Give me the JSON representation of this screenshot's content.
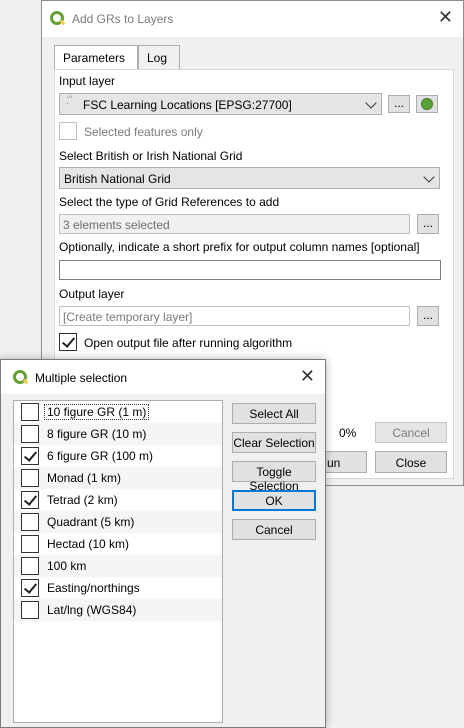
{
  "main_dialog": {
    "title": "Add GRs to Layers",
    "tabs": [
      {
        "label": "Parameters"
      },
      {
        "label": "Log"
      }
    ],
    "input_layer_label": "Input layer",
    "input_layer_value": "FSC Learning Locations [EPSG:27700]",
    "selected_features_label": "Selected features only",
    "grid_label": "Select British or Irish National Grid",
    "grid_value": "British National Grid",
    "gr_type_label": "Select the type of Grid References to add",
    "gr_type_value": "3 elements selected",
    "prefix_label": "Optionally, indicate a short prefix for output column names [optional]",
    "prefix_value": "",
    "output_label": "Output layer",
    "output_placeholder": "[Create temporary layer]",
    "open_output_label": "Open output file after running algorithm",
    "ellipsis": "...",
    "progress": "0%",
    "cancel_label": "Cancel",
    "run_label": "un",
    "close_label": "Close"
  },
  "multiple_selection": {
    "title": "Multiple selection",
    "items": [
      {
        "label": "10 figure GR (1 m)",
        "checked": false
      },
      {
        "label": "8 figure GR (10 m)",
        "checked": false
      },
      {
        "label": "6 figure GR (100 m)",
        "checked": true
      },
      {
        "label": "Monad (1 km)",
        "checked": false
      },
      {
        "label": "Tetrad (2 km)",
        "checked": true
      },
      {
        "label": "Quadrant (5 km)",
        "checked": false
      },
      {
        "label": "Hectad (10 km)",
        "checked": false
      },
      {
        "label": "100 km",
        "checked": false
      },
      {
        "label": "Easting/northings",
        "checked": true
      },
      {
        "label": "Lat/lng (WGS84)",
        "checked": false
      }
    ],
    "buttons": {
      "select_all": "Select All",
      "clear_selection": "Clear Selection",
      "toggle_selection": "Toggle Selection",
      "ok": "OK",
      "cancel": "Cancel"
    }
  }
}
